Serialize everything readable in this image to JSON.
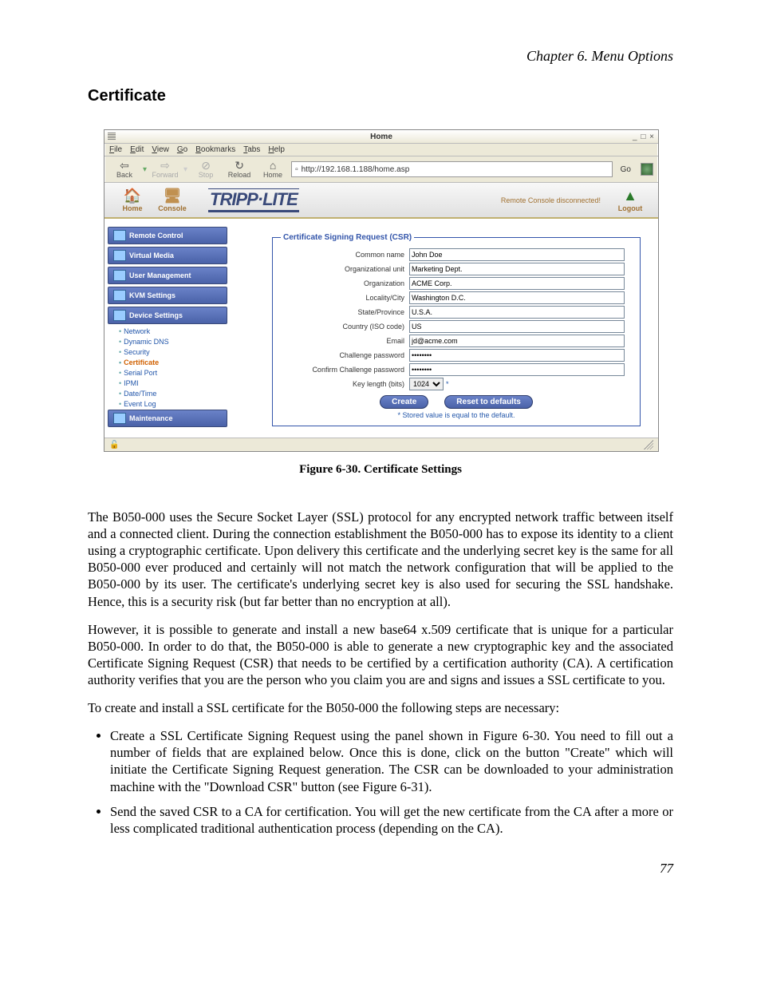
{
  "chapter_header": "Chapter 6. Menu Options",
  "section_title": "Certificate",
  "figure_caption": "Figure 6-30. Certificate Settings",
  "page_number": "77",
  "browser": {
    "window_title": "Home",
    "window_controls": "_ □ ×",
    "menus": [
      "File",
      "Edit",
      "View",
      "Go",
      "Bookmarks",
      "Tabs",
      "Help"
    ],
    "toolbar": {
      "back": "Back",
      "forward": "Forward",
      "stop": "Stop",
      "reload": "Reload",
      "home": "Home",
      "go": "Go"
    },
    "url": "http://192.168.1.188/home.asp"
  },
  "app": {
    "header": {
      "home": "Home",
      "console": "Console",
      "brand": "TRIPP·LITE",
      "status": "Remote Console disconnected!",
      "logout": "Logout"
    },
    "sidebar": {
      "remote_control": "Remote Control",
      "virtual_media": "Virtual Media",
      "user_management": "User Management",
      "kvm_settings": "KVM Settings",
      "device_settings": "Device Settings",
      "subs": {
        "network": "Network",
        "dynamic_dns": "Dynamic DNS",
        "security": "Security",
        "certificate": "Certificate",
        "serial_port": "Serial Port",
        "ipmi": "IPMI",
        "date_time": "Date/Time",
        "event_log": "Event Log"
      },
      "maintenance": "Maintenance"
    }
  },
  "csr": {
    "legend": "Certificate Signing Request (CSR)",
    "labels": {
      "common_name": "Common name",
      "org_unit": "Organizational unit",
      "organization": "Organization",
      "locality": "Locality/City",
      "state": "State/Province",
      "country": "Country (ISO code)",
      "email": "Email",
      "challenge": "Challenge password",
      "confirm": "Confirm Challenge password",
      "key_length": "Key length (bits)"
    },
    "values": {
      "common_name": "John Doe",
      "org_unit": "Marketing Dept.",
      "organization": "ACME Corp.",
      "locality": "Washington D.C.",
      "state": "U.S.A.",
      "country": "US",
      "email": "jd@acme.com",
      "challenge": "********",
      "confirm": "********",
      "key_length": "1024"
    },
    "buttons": {
      "create": "Create",
      "reset": "Reset to defaults"
    },
    "note": "* Stored value is equal to the default."
  },
  "body": {
    "p1": "The B050-000 uses the Secure Socket Layer (SSL) protocol for any encrypted network traffic between itself and a connected client. During the connection establishment the B050-000 has to expose its identity to a client using a cryptographic certificate. Upon delivery this certificate and the underlying secret key is the same for all B050-000 ever produced and certainly will not match the network configuration that will be applied to the B050-000 by its user. The certificate's underlying secret key is also used for securing the SSL handshake. Hence, this is a security risk (but far better than no encryption at all).",
    "p2": "However, it is possible to generate and install a new base64 x.509 certificate that is unique for a particular B050-000. In order to do that, the B050-000 is able to generate a new cryptographic key and the associated Certificate Signing Request (CSR) that needs to be certified by a certification authority (CA). A certification authority verifies that you are the person who you claim you are and signs and issues a SSL certificate to you.",
    "p3": "To create and install a SSL certificate for the B050-000 the following steps are necessary:",
    "li1": "Create a SSL Certificate Signing Request using the panel shown in Figure 6-30. You need to fill out a number of fields that are explained below. Once this is done, click on the button \"Create\" which will initiate the Certificate Signing Request generation. The CSR can be downloaded to your administration machine with the \"Download CSR\" button (see Figure 6-31).",
    "li2": "Send the saved CSR to a CA for certification. You will get the new certificate from the CA after a more or less complicated traditional authentication process (depending on the CA)."
  }
}
